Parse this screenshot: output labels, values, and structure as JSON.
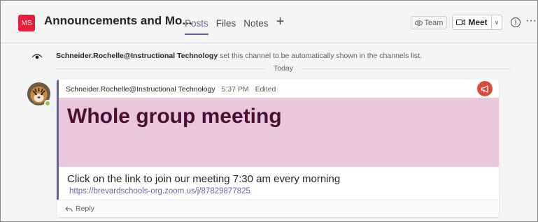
{
  "header": {
    "team_avatar": "MS",
    "channel_title": "Announcements and Mo...",
    "tabs": [
      {
        "label": "Posts",
        "active": true
      },
      {
        "label": "Files",
        "active": false
      },
      {
        "label": "Notes",
        "active": false
      }
    ],
    "add_tab_icon": "plus-icon",
    "team_button": "Team",
    "meet_button": "Meet",
    "accent_color": "#6264a7"
  },
  "system_message": {
    "author": "Schneider.Rochelle@Instructional Technology",
    "text": " set this channel to be automatically shown in the channels list.",
    "date_divider": "Today"
  },
  "post": {
    "author": "Schneider.Rochelle@Instructional Technology",
    "time": "5:37 PM",
    "status": "Edited",
    "headline": "Whole group meeting",
    "body": "Click on the link to join our meeting 7:30 am every morning",
    "link": "https://brevardschools-org.zoom.us/j/87829877825",
    "reply_label": "Reply",
    "headline_bg": "#e8c8da",
    "headline_color": "#4a0f35"
  }
}
